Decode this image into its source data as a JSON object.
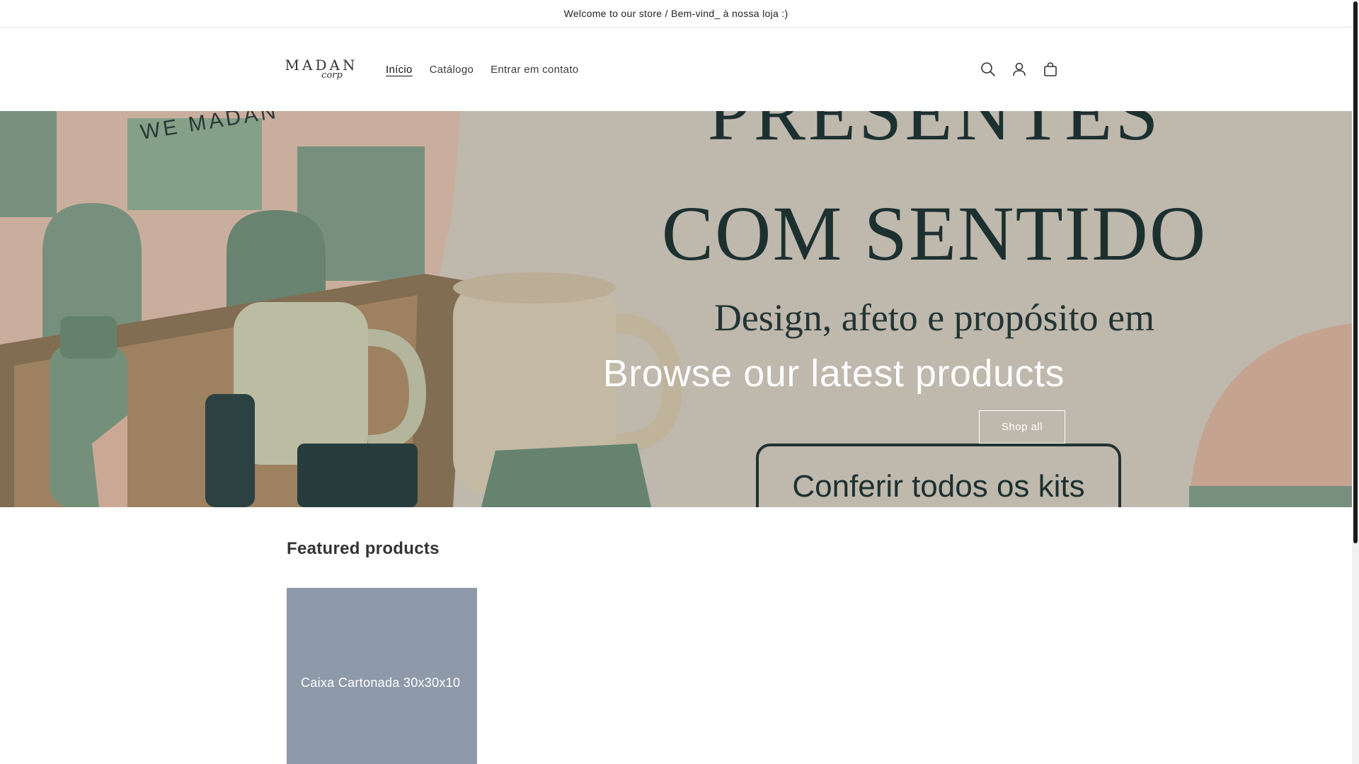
{
  "announcement": {
    "text": "Welcome to our store / Bem-vind_ à nossa loja :)"
  },
  "header": {
    "logo": {
      "main": "MADAN",
      "sub": "corp"
    },
    "nav": [
      {
        "label": "Início",
        "active": true
      },
      {
        "label": "Catálogo",
        "active": false
      },
      {
        "label": "Entrar em contato",
        "active": false
      }
    ],
    "icons": [
      "search-icon",
      "account-icon",
      "cart-icon"
    ]
  },
  "hero": {
    "image_text": {
      "line1": "PRESENTES",
      "line2": "COM SENTIDO",
      "line3": "Design, afeto e propósito em",
      "box_label": "Conferir todos os kits",
      "box_brand": "WE MADAN"
    },
    "title": "Browse our latest products",
    "button_label": "Shop all"
  },
  "featured": {
    "title": "Featured products",
    "products": [
      {
        "name": "Caixa Cartonada 30x30x10"
      }
    ]
  },
  "colors": {
    "product_placeholder": "#8e99a9",
    "hero_text_dark": "#1f3333",
    "accent_green": "#7e9a85",
    "accent_pink": "#d9b2a0"
  }
}
